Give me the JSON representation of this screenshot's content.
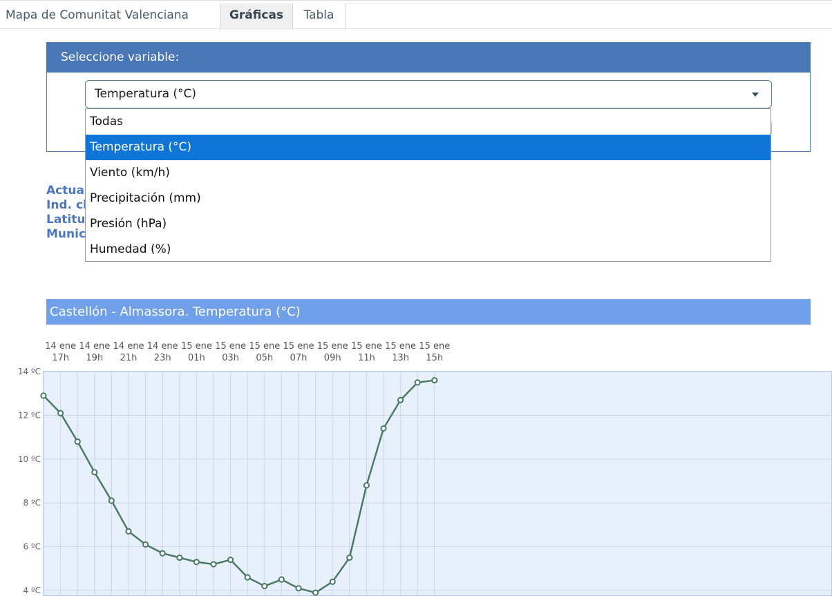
{
  "tabs": [
    {
      "label": "Mapa de Comunitat Valenciana"
    },
    {
      "label": "Gráficas"
    },
    {
      "label": "Tabla"
    }
  ],
  "panel": {
    "header": "Seleccione variable:",
    "select_value": "Temperatura (°C)",
    "options": [
      "Todas",
      "Temperatura (°C)",
      "Viento (km/h)",
      "Precipitación (mm)",
      "Presión (hPa)",
      "Humedad (%)"
    ],
    "selected_index": 1
  },
  "info_partial": [
    "Actua",
    "Ind. cl",
    "Latitu",
    "Munic"
  ],
  "chart_title": "Castellón - Almassora. Temperatura (°C)",
  "chart_data": {
    "type": "line",
    "x_tick_labels": [
      [
        "14 ene",
        "17h"
      ],
      [
        "14 ene",
        "19h"
      ],
      [
        "14 ene",
        "21h"
      ],
      [
        "14 ene",
        "23h"
      ],
      [
        "15 ene",
        "01h"
      ],
      [
        "15 ene",
        "03h"
      ],
      [
        "15 ene",
        "05h"
      ],
      [
        "15 ene",
        "07h"
      ],
      [
        "15 ene",
        "09h"
      ],
      [
        "15 ene",
        "11h"
      ],
      [
        "15 ene",
        "13h"
      ],
      [
        "15 ene",
        "15h"
      ]
    ],
    "y_tick_labels": [
      "14 ºC",
      "12 ºC",
      "10 ºC",
      "8 ºC",
      "6 ºC",
      "4 ºC"
    ],
    "ylim": [
      4,
      14
    ],
    "series": [
      {
        "values": [
          12.9,
          12.1,
          10.8,
          9.4,
          8.1,
          6.7,
          6.1,
          5.7,
          5.5,
          5.3,
          5.2,
          5.4,
          4.6,
          4.2,
          4.5,
          4.1,
          3.9,
          4.4,
          5.5,
          8.8,
          11.4,
          12.7,
          13.5,
          13.6
        ]
      }
    ],
    "colors": {
      "line": "#4a7a64",
      "plot_bg": "#e8f0fc",
      "grid": "#c9d6ea",
      "title_bar": "#70a0ea"
    }
  }
}
